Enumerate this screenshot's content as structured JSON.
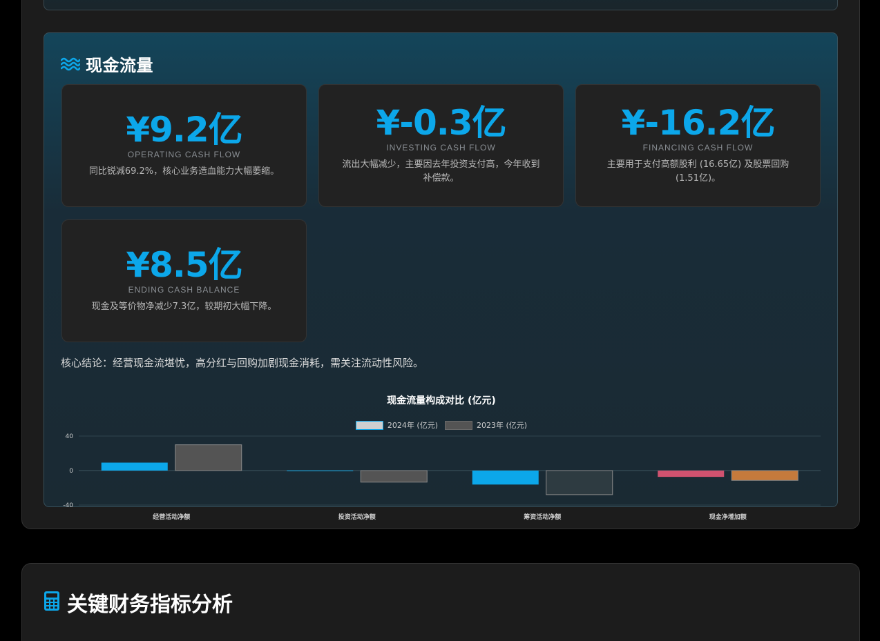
{
  "cash_flow": {
    "title": "现金流量",
    "icon": "water-waves-icon",
    "metrics": [
      {
        "value": "¥9.2亿",
        "label": "OPERATING CASH FLOW",
        "desc": "同比锐减69.2%，核心业务造血能力大幅萎缩。"
      },
      {
        "value": "¥-0.3亿",
        "label": "INVESTING CASH FLOW",
        "desc": "流出大幅减少，主要因去年投资支付高，今年收到补偿款。"
      },
      {
        "value": "¥-16.2亿",
        "label": "FINANCING CASH FLOW",
        "desc": "主要用于支付高额股利 (16.65亿) 及股票回购 (1.51亿)。"
      },
      {
        "value": "¥8.5亿",
        "label": "ENDING CASH BALANCE",
        "desc": "现金及等价物净减少7.3亿，较期初大幅下降。"
      }
    ],
    "conclusion": "核心结论：经营现金流堪忧，高分红与回购加剧现金消耗，需关注流动性风险。"
  },
  "chart_data": {
    "type": "bar",
    "title": "现金流量构成对比 (亿元)",
    "categories": [
      "经营活动净额",
      "投资活动净额",
      "筹资活动净额",
      "现金净增加额"
    ],
    "series": [
      {
        "name": "2024年 (亿元)",
        "values": [
          9.2,
          -0.3,
          -16.2,
          -7.3
        ]
      },
      {
        "name": "2023年 (亿元)",
        "values": [
          29.9,
          -13.4,
          -27.9,
          -11.4
        ]
      }
    ],
    "ylim": [
      -40,
      40
    ],
    "yticks": [
      40,
      0,
      -40
    ],
    "grid": true,
    "legend_position": "top",
    "colors": {
      "series_2024": [
        "#0ca7ea",
        "#0ca7ea",
        "#0ca7ea",
        "#d0526f"
      ],
      "series_2023": [
        "#545454",
        "#545454",
        "#2e3b41",
        "#c57a3c"
      ],
      "legend_2024": "#cfcfcf",
      "legend_2023": "#545454"
    }
  },
  "next_section": {
    "title": "关键财务指标分析",
    "icon": "calculator-icon"
  }
}
